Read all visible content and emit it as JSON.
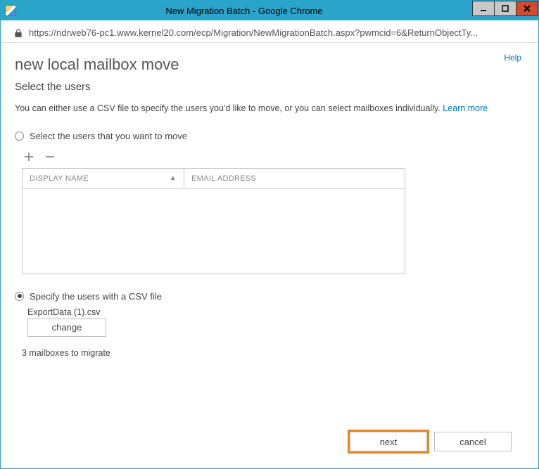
{
  "window": {
    "title": "New Migration Batch - Google Chrome"
  },
  "address": {
    "url": "https://ndrweb76-pc1.www.kernel20.com/ecp/Migration/NewMigrationBatch.aspx?pwmcid=6&ReturnObjectTy..."
  },
  "header": {
    "help_label": "Help",
    "page_title": "new local mailbox move",
    "subtitle": "Select the users",
    "intro_text": "You can either use a CSV file to specify the users you'd like to move, or you can select mailboxes individually. ",
    "learn_more": "Learn more"
  },
  "options": {
    "select_users_label": "Select the users that you want to move",
    "csv_label": "Specify the users with a CSV file"
  },
  "grid": {
    "col_display_name": "DISPLAY NAME",
    "col_email": "EMAIL ADDRESS"
  },
  "csv": {
    "filename": "ExportData (1).csv",
    "change_label": "change",
    "status": "3 mailboxes to migrate"
  },
  "footer": {
    "next_label": "next",
    "cancel_label": "cancel"
  }
}
